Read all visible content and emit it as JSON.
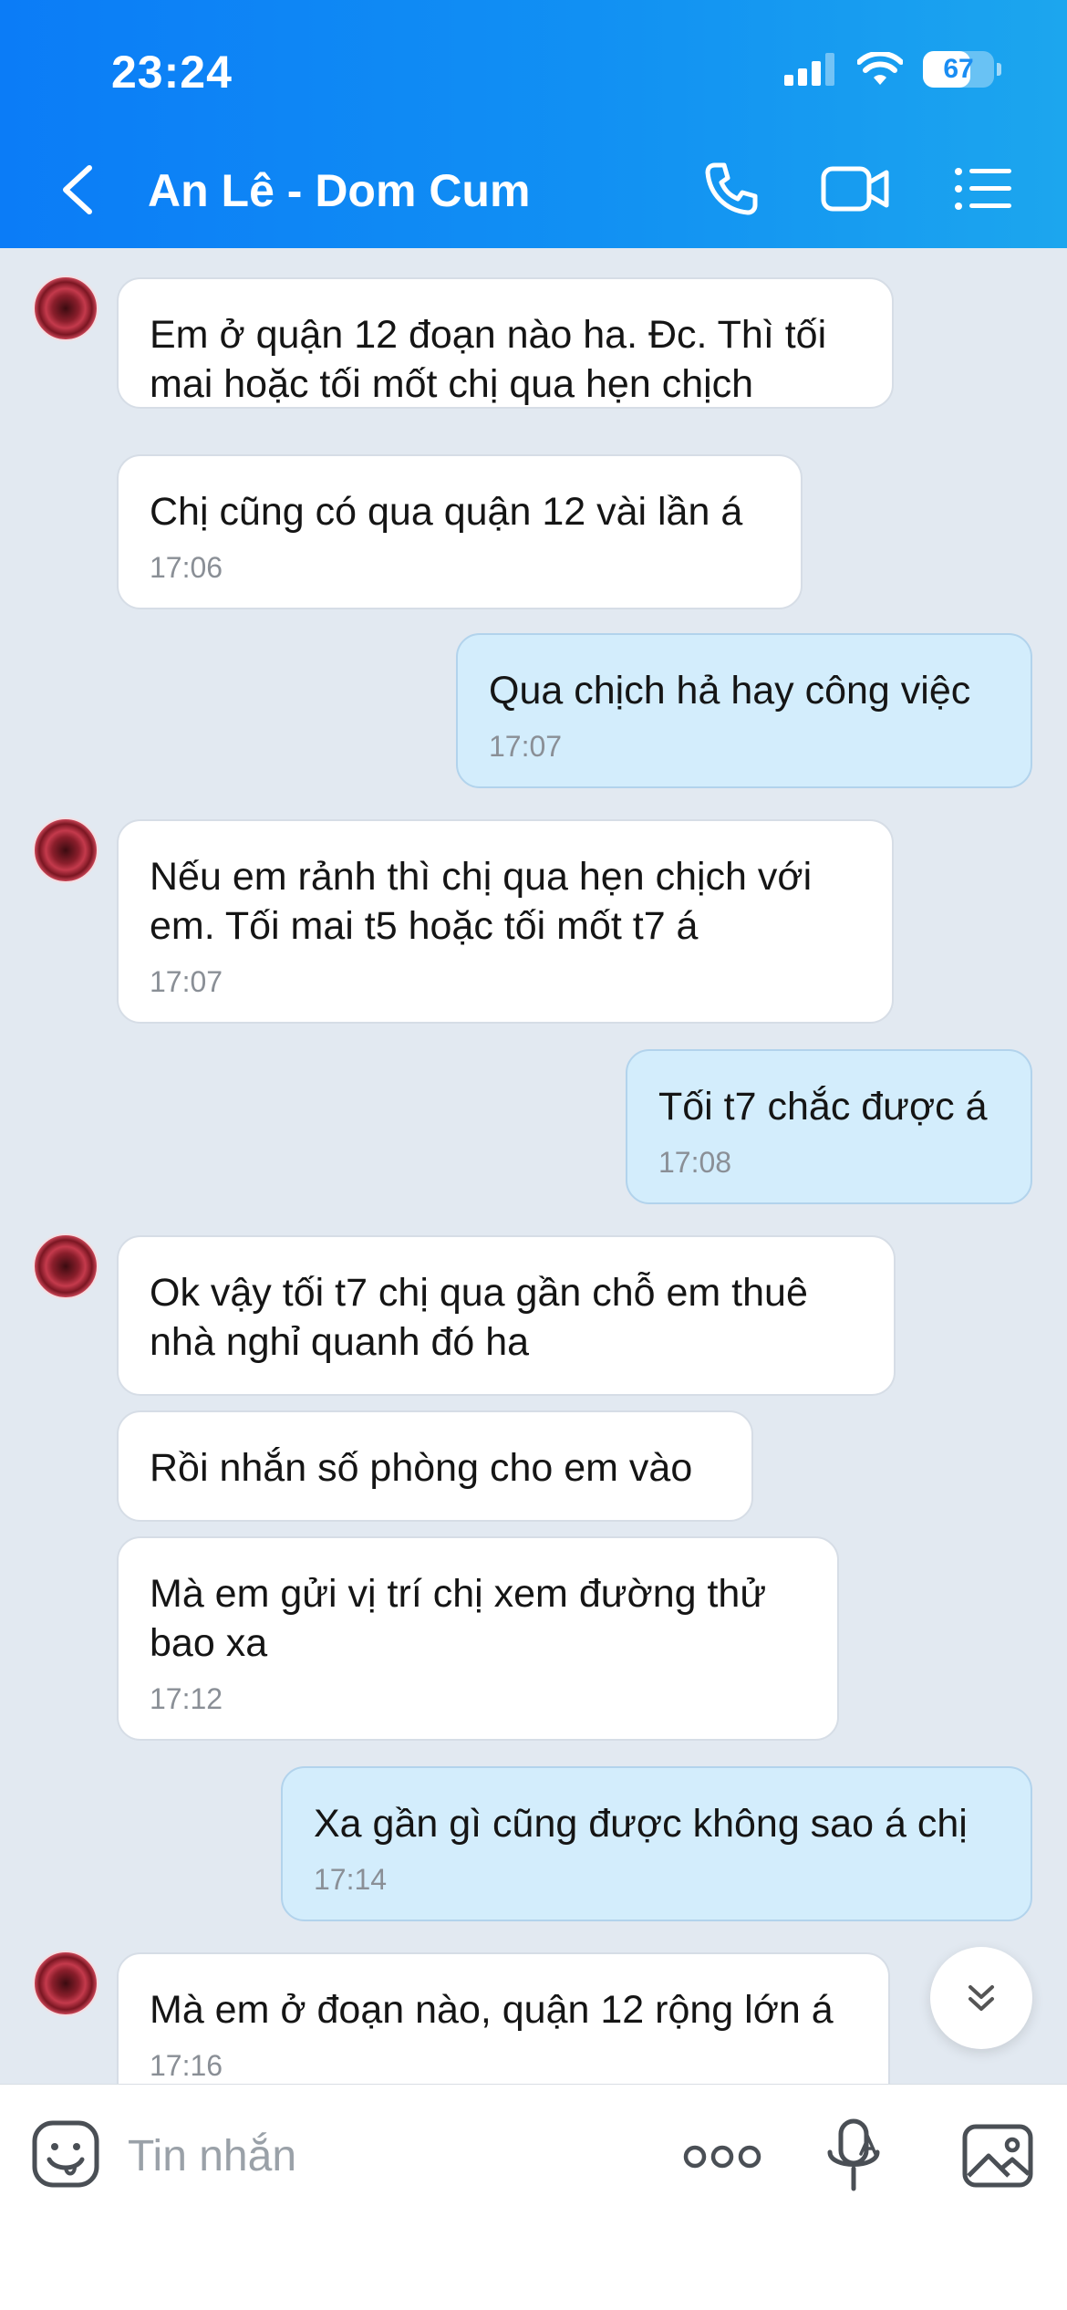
{
  "status_bar": {
    "time": "23:24",
    "battery_level": "67",
    "battery_fraction": 0.67
  },
  "header": {
    "title": "An Lê - Dom Cum"
  },
  "messages": [
    {
      "direction": "in",
      "avatar": true,
      "text": "Em ở quận 12 đoạn nào ha. Đc. Thì tối mai hoặc tối mốt chị qua hẹn chịch",
      "time": ""
    },
    {
      "direction": "in",
      "avatar": false,
      "text": "Chị cũng có qua quận 12 vài lần á",
      "time": "17:06"
    },
    {
      "direction": "out",
      "avatar": false,
      "text": "Qua chịch hả hay công việc",
      "time": "17:07"
    },
    {
      "direction": "in",
      "avatar": true,
      "text": "Nếu em rảnh thì chị qua hẹn chịch với em. Tối mai t5 hoặc tối mốt t7 á",
      "time": "17:07"
    },
    {
      "direction": "out",
      "avatar": false,
      "text": "Tối t7 chắc được á",
      "time": "17:08"
    },
    {
      "direction": "in",
      "avatar": true,
      "text": "Ok vậy tối t7 chị qua gần chỗ em thuê nhà nghỉ quanh đó ha",
      "time": ""
    },
    {
      "direction": "in",
      "avatar": false,
      "text": "Rồi nhắn số phòng cho em vào",
      "time": ""
    },
    {
      "direction": "in",
      "avatar": false,
      "text": "Mà em gửi vị trí chị xem đường thử bao xa",
      "time": "17:12"
    },
    {
      "direction": "out",
      "avatar": false,
      "text": "Xa gần gì cũng được không sao á chị",
      "time": "17:14"
    },
    {
      "direction": "in",
      "avatar": true,
      "text": "Mà em ở đoạn nào, quận 12 rộng lớn á",
      "time": "17:16"
    }
  ],
  "composer": {
    "placeholder": "Tin nhắn",
    "value": ""
  },
  "colors": {
    "header_start": "#0b7cf7",
    "header_end": "#1ca6ee",
    "chat_background": "#e2e9f1",
    "incoming_bubble": "#ffffff",
    "outgoing_bubble": "#d3edfc",
    "timestamp": "#8a8f96"
  },
  "icons": {
    "back": "chevron-left-icon",
    "call": "phone-icon",
    "video": "video-camera-icon",
    "menu": "list-menu-icon",
    "sticker": "sticker-face-icon",
    "more": "more-dots-icon",
    "voice": "microphone-icon",
    "image": "image-icon",
    "scroll": "double-chevron-down-icon"
  }
}
